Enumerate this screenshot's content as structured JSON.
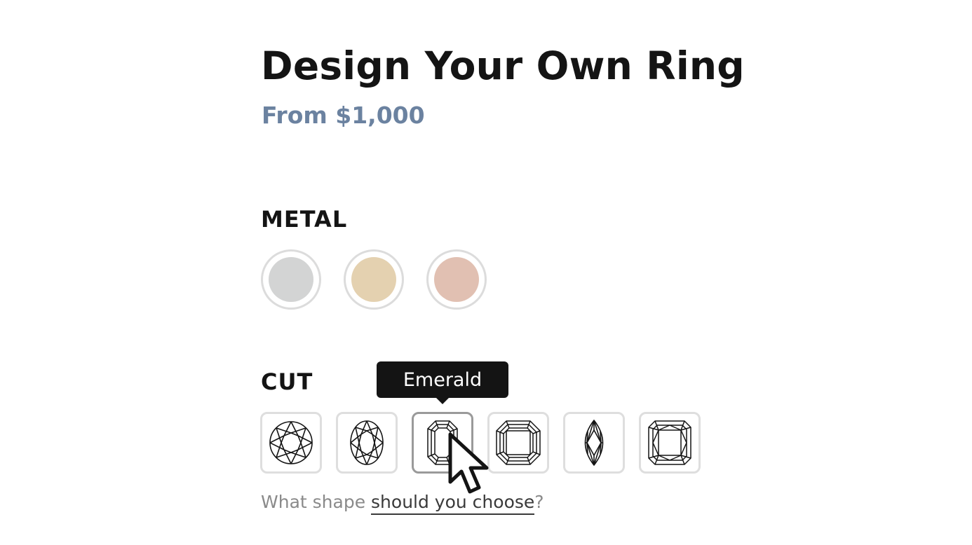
{
  "header": {
    "title": "Design Your Own Ring",
    "price": "From $1,000"
  },
  "metal": {
    "label": "METAL",
    "options": [
      {
        "name": "white-gold",
        "color": "#d3d4d4"
      },
      {
        "name": "yellow-gold",
        "color": "#e4d1b0"
      },
      {
        "name": "rose-gold",
        "color": "#e1c0b2"
      }
    ]
  },
  "cut": {
    "label": "CUT",
    "tooltip": "Emerald",
    "options": [
      "round-cut-icon",
      "oval-cut-icon",
      "emerald-cut-icon",
      "asscher-cut-icon",
      "marquise-cut-icon",
      "radiant-cut-icon"
    ],
    "selected_index": 2
  },
  "help": {
    "prefix": "What shape ",
    "link": "should you choose",
    "suffix": "?"
  },
  "colors": {
    "price": "#6b82a0",
    "tooltip_bg": "#141414",
    "border_default": "#dedede",
    "border_hover": "#9a9a9a"
  }
}
